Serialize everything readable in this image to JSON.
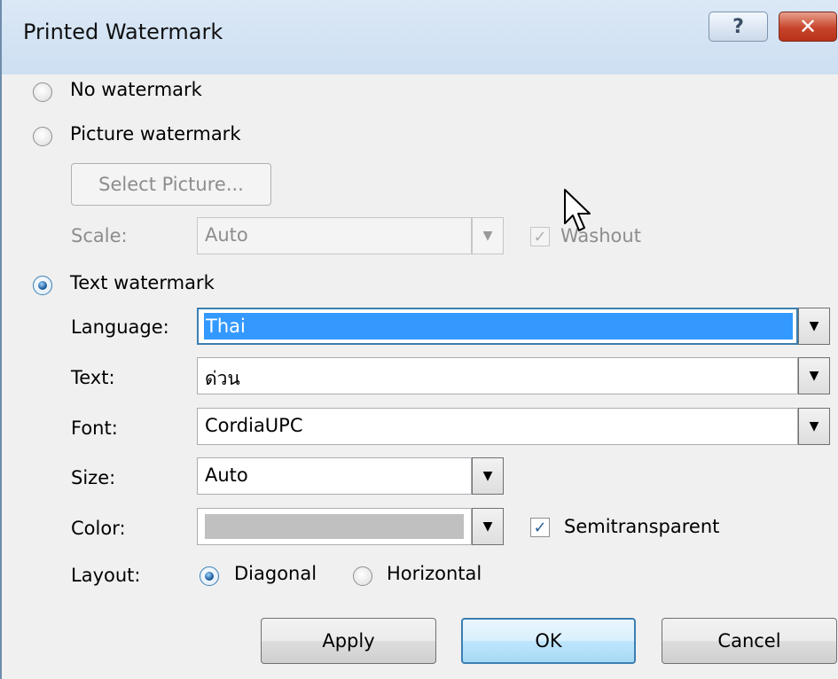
{
  "window": {
    "title": "Printed Watermark",
    "help_label": "?",
    "close_label": "✕"
  },
  "options": {
    "no_watermark": "No watermark",
    "picture_watermark": "Picture watermark",
    "text_watermark": "Text watermark",
    "selected": "text_watermark"
  },
  "picture": {
    "select_button": "Select Picture...",
    "scale_label": "Scale:",
    "scale_value": "Auto",
    "washout_label": "Washout",
    "washout_checked": true
  },
  "text": {
    "language_label": "Language:",
    "language_value": "Thai",
    "text_label": "Text:",
    "text_value": "ด่วน",
    "font_label": "Font:",
    "font_value": "CordiaUPC",
    "size_label": "Size:",
    "size_value": "Auto",
    "color_label": "Color:",
    "color_value": "#c0c0c0",
    "semitransparent_label": "Semitransparent",
    "semitransparent_checked": true,
    "layout_label": "Layout:",
    "layout_diagonal": "Diagonal",
    "layout_horizontal": "Horizontal",
    "layout_selected": "Diagonal"
  },
  "buttons": {
    "apply": "Apply",
    "ok": "OK",
    "cancel": "Cancel"
  },
  "icons": {
    "dropdown": "▼",
    "check": "✓"
  }
}
